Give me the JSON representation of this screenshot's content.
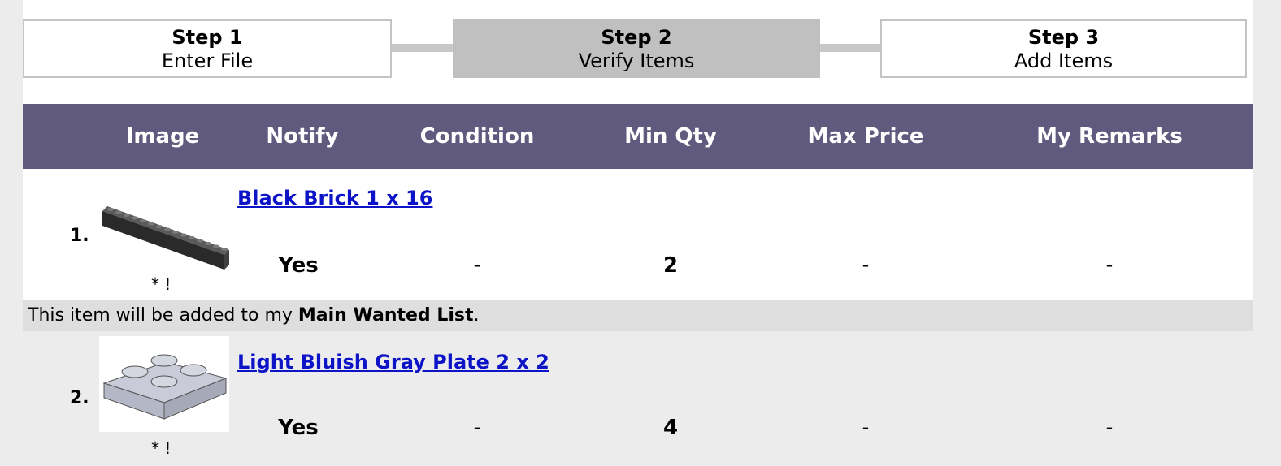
{
  "steps": [
    {
      "title": "Step 1",
      "subtitle": "Enter File"
    },
    {
      "title": "Step 2",
      "subtitle": "Verify Items"
    },
    {
      "title": "Step 3",
      "subtitle": "Add Items"
    }
  ],
  "active_step": 2,
  "table": {
    "headers": {
      "image": "Image",
      "notify": "Notify",
      "condition": "Condition",
      "min_qty": "Min Qty",
      "max_price": "Max Price",
      "remarks": "My Remarks"
    },
    "rows": [
      {
        "index": "1.",
        "name": "Black Brick 1 x 16",
        "image_icon": "black-brick-1x16",
        "marks": "* !",
        "notify": "Yes",
        "condition": "-",
        "min_qty": "2",
        "max_price": "-",
        "remarks": "-"
      },
      {
        "index": "2.",
        "name": "Light Bluish Gray Plate 2 x 2",
        "image_icon": "light-bluish-gray-plate-2x2",
        "marks": "* !",
        "notify": "Yes",
        "condition": "-",
        "min_qty": "4",
        "max_price": "-",
        "remarks": "-"
      }
    ],
    "notice": {
      "prefix": "This item will be added to my ",
      "list_name": "Main Wanted List",
      "suffix": "."
    }
  },
  "colors": {
    "header_bg": "#5f5a7e",
    "active_step_bg": "#c0c0c0",
    "link": "#0d14c8",
    "notice_bg": "#dedede"
  }
}
